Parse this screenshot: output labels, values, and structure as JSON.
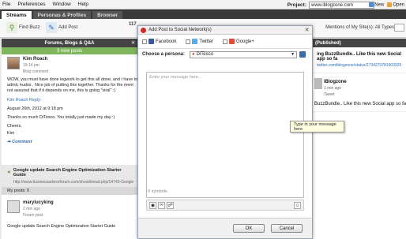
{
  "menubar": {
    "items": [
      {
        "label": "File"
      },
      {
        "label": "Preferences"
      },
      {
        "label": "Window"
      },
      {
        "label": "Help"
      }
    ],
    "project_label": "Project:",
    "project_value": "www.iblogzone.com",
    "new_label": "New",
    "open_label": "Open"
  },
  "tabs": [
    {
      "label": "Streams",
      "active": true
    },
    {
      "label": "Personas & Profiles",
      "active": false
    },
    {
      "label": "Browser",
      "active": false
    }
  ],
  "toolbar": {
    "find_buzz": "Find Buzz",
    "add_post": "Add Post",
    "count": "117",
    "mentions": "Mentions of My Site(s): All Types"
  },
  "left_column": {
    "header": "Forums, Blogs & Q&A",
    "new_posts": "3 new posts",
    "post1": {
      "author": "Kim Roach",
      "time": "19:14 pm",
      "source": "Blog comment",
      "body_lines": [
        "WOW, you must have done legwork to get this all done, and I have to",
        "admit, kudos . Nice job of putting this together. Thanks for the ment",
        "not assured that if it depends on me, this is going \"viral\" :)"
      ],
      "reply": "Kim Roach Reply:",
      "date": "August 26th, 2012 at 9:18 pm",
      "thanks": "Thanks so much DiTesco. You totally just made my day :)",
      "cheers": "Cheers,",
      "sign": "Kim",
      "comment": "Comment"
    },
    "post2": {
      "title": "Google update Search Engine Optimization Starter Guide",
      "url": "http://www.businessadviceforum.com/showthread.php/14743-Google"
    },
    "myposts": "My posts: 0",
    "post3": {
      "author": "marylucyking",
      "time": "2 min ago",
      "source": "Forum post",
      "body": "Google update Search Engine Optimization Starter Guide"
    }
  },
  "right_column": {
    "header": "(Published)",
    "item1": {
      "title": "ing BuzzBundle.. Like this new Social app so fa",
      "sub": "twitter.com/iblogzone/status/2734370781903925",
      "meta": ""
    },
    "item2": {
      "title": "iBlogzone",
      "time": "1 min ago",
      "type": "Tweet",
      "body": "BuzzBundle.. Like this new Social app so fa"
    }
  },
  "dialog": {
    "title": "Add Post to Social Network(s)",
    "networks": [
      {
        "label": "Facebook",
        "color": "#3b5998"
      },
      {
        "label": "Twitter",
        "color": "#55acee"
      },
      {
        "label": "Google+",
        "color": "#dd4b39"
      }
    ],
    "persona_label": "Choose a persona:",
    "persona_value": "DiTesco",
    "placeholder": "Enter your message here...",
    "symbols": "0 symbols",
    "ok": "OK",
    "cancel": "Cancel"
  },
  "tooltip": "Type in your message here"
}
